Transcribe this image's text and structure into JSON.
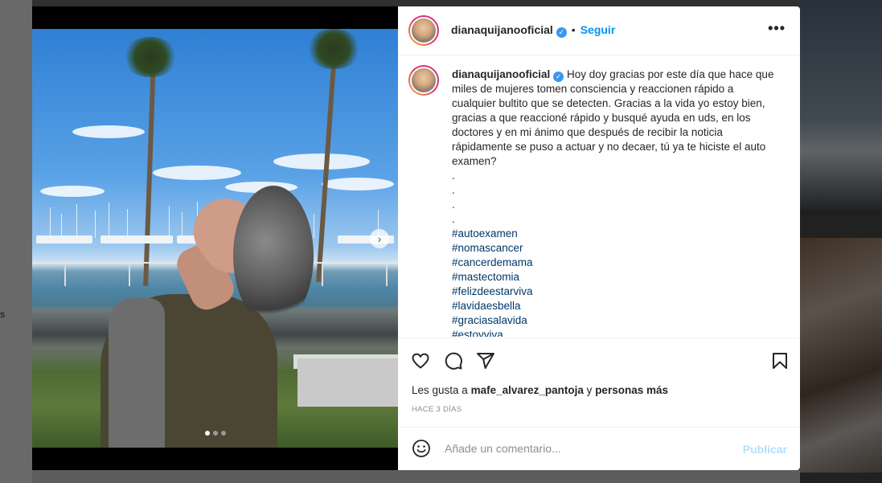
{
  "background": {
    "left_edge_text": "s"
  },
  "post": {
    "username": "dianaquijanooficial",
    "verified_mark": "✓",
    "separator": "•",
    "follow_label": "Seguir",
    "more_label": "•••",
    "caption": {
      "username": "dianaquijanooficial",
      "text": "Hoy doy gracias por este día que hace que miles de mujeres tomen consciencia y reaccionen rápido a cualquier bultito que se detecten. Gracias a la vida yo estoy bien, gracias a que reaccioné rápido y busqué ayuda en uds, en los doctores y en mi ánimo que después de recibir la noticia rápidamente se puso a actuar y no decaer, tú ya te hiciste el auto examen?",
      "dots": [
        ".",
        ".",
        ".",
        "."
      ],
      "hashtags": [
        "#autoexamen",
        "#nomascancer",
        "#cancerdemama",
        "#mastectomia",
        "#felizdeestarviva",
        "#lavidaesbella",
        "#graciasalavida",
        "#estoyviva"
      ]
    },
    "likes": {
      "prefix": "Les gusta a",
      "user": "mafe_alvarez_pantoja",
      "connector": "y",
      "others": "personas más"
    },
    "time_ago": "HACE 3 DÍAS",
    "comment": {
      "placeholder": "Añade un comentario...",
      "publish_label": "Publicar"
    },
    "carousel": {
      "count": 3,
      "active_index": 0
    }
  },
  "colors": {
    "accent_blue": "#0095f6",
    "verified_blue": "#3897f0",
    "hashtag": "#00376b",
    "publish_disabled": "#b2dffc"
  },
  "icons": [
    "heart-icon",
    "comment-icon",
    "share-icon",
    "bookmark-icon",
    "emoji-icon",
    "chevron-right-icon"
  ]
}
